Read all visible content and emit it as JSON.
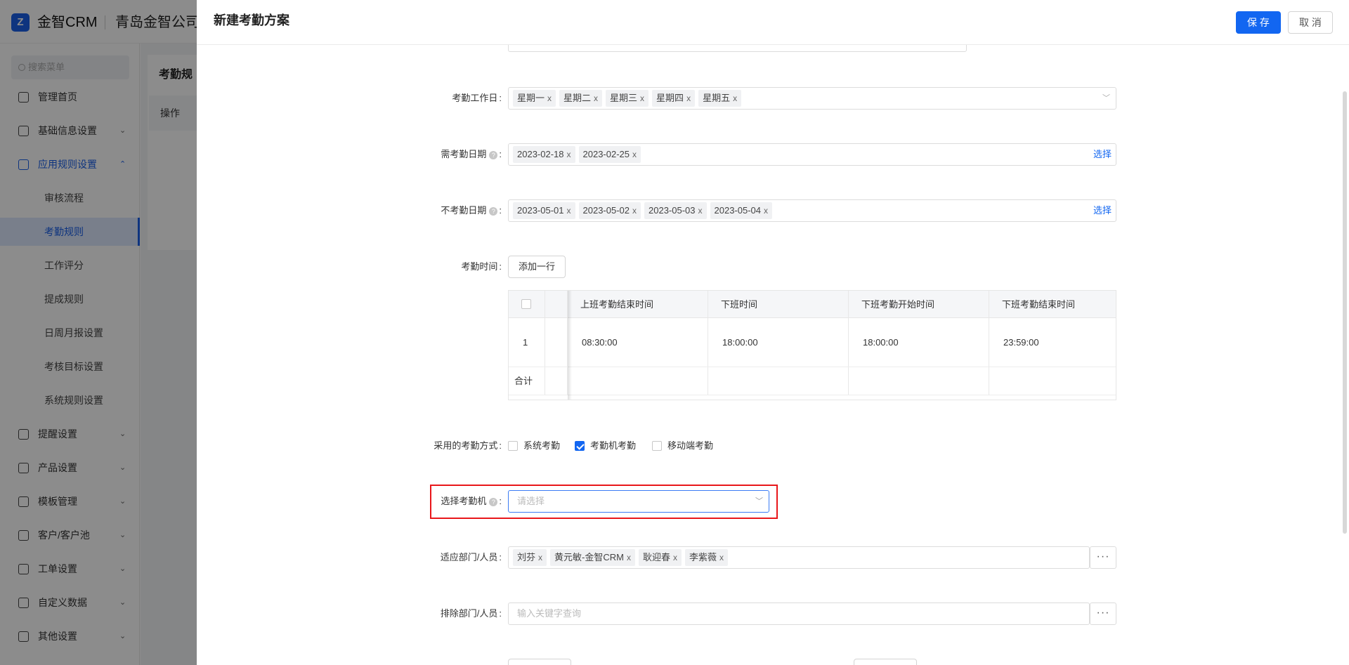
{
  "app": {
    "logo_text": "金智CRM",
    "logo_letter": "Z",
    "company": "青岛金智公司",
    "search_placeholder": "搜索菜单"
  },
  "sidebar": {
    "items": [
      {
        "label": "管理首页",
        "icon": "home-icon"
      },
      {
        "label": "基础信息设置",
        "icon": "cube-icon",
        "chevron": "⌄"
      },
      {
        "label": "应用规则设置",
        "icon": "document-icon",
        "chevron": "⌃",
        "open": true
      },
      {
        "label": "提醒设置",
        "icon": "bell-icon",
        "chevron": "⌄"
      },
      {
        "label": "产品设置",
        "icon": "cube-icon",
        "chevron": "⌄"
      },
      {
        "label": "模板管理",
        "icon": "template-icon",
        "chevron": "⌄"
      },
      {
        "label": "客户/客户池",
        "icon": "user-icon",
        "chevron": "⌄"
      },
      {
        "label": "工单设置",
        "icon": "ticket-icon",
        "chevron": "⌄"
      },
      {
        "label": "自定义数据",
        "icon": "edit-icon",
        "chevron": "⌄"
      },
      {
        "label": "其他设置",
        "icon": "grid-icon",
        "chevron": "⌄"
      }
    ],
    "subitems": [
      {
        "label": "审核流程"
      },
      {
        "label": "考勤规则",
        "active": true
      },
      {
        "label": "工作评分"
      },
      {
        "label": "提成规则"
      },
      {
        "label": "日周月报设置"
      },
      {
        "label": "考核目标设置"
      },
      {
        "label": "系统规则设置"
      }
    ]
  },
  "background_page": {
    "title": "考勤规",
    "table_header": "操作"
  },
  "drawer": {
    "title": "新建考勤方案",
    "save_label": "保 存",
    "cancel_label": "取 消"
  },
  "form": {
    "workdays": {
      "label": "考勤工作日",
      "tags": [
        "星期一",
        "星期二",
        "星期三",
        "星期四",
        "星期五"
      ]
    },
    "required_dates": {
      "label": "需考勤日期",
      "tags": [
        "2023-02-18",
        "2023-02-25"
      ],
      "action": "选择"
    },
    "excluded_dates": {
      "label": "不考勤日期",
      "tags": [
        "2023-05-01",
        "2023-05-02",
        "2023-05-03",
        "2023-05-04"
      ],
      "action": "选择"
    },
    "attendance_time": {
      "label": "考勤时间",
      "add_row": "添加一行",
      "columns": [
        "上班考勤结束时间",
        "下班时间",
        "下班考勤开始时间",
        "下班考勤结束时间"
      ],
      "rows": [
        {
          "index": "1",
          "cells": [
            "08:30:00",
            "18:00:00",
            "18:00:00",
            "23:59:00"
          ]
        }
      ],
      "total_label": "合计"
    },
    "methods": {
      "label": "采用的考勤方式",
      "options": [
        {
          "label": "系统考勤",
          "checked": false
        },
        {
          "label": "考勤机考勤",
          "checked": true
        },
        {
          "label": "移动端考勤",
          "checked": false
        }
      ]
    },
    "machine": {
      "label": "选择考勤机",
      "placeholder": "请选择"
    },
    "departments": {
      "label": "适应部门/人员",
      "tags": [
        "刘芬",
        "黄元敏-金智CRM",
        "耿迎春",
        "李紫薇"
      ]
    },
    "exclude": {
      "label": "排除部门/人员",
      "placeholder": "输入关键字查询"
    }
  },
  "colors": {
    "primary": "#1266f1",
    "highlight": "#e8161a",
    "overlay": "rgba(0,0,0,0.45)"
  }
}
